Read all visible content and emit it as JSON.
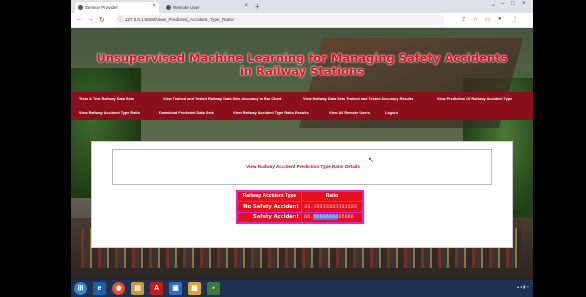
{
  "browser": {
    "tabs": [
      {
        "label": "Service Provider"
      },
      {
        "label": "Remote User"
      }
    ],
    "new_tab": "+",
    "url": "127.0.0.1:8000/View_Predicted_Accident_Type_Ratio/"
  },
  "site": {
    "title": "Unsupervised Machine Learning for Managing Safety Accidents in Railway Stations"
  },
  "menu": {
    "row1": [
      {
        "label": "Train & Test Railway Data Sets"
      },
      {
        "label": "View Trained and Tested Railway Data Sets Accuracy in Bar Chart"
      },
      {
        "label": "View Railway Data Sets Trained and Tested Accuracy Results"
      },
      {
        "label": "View Prediction Of Railway Accident Type"
      }
    ],
    "row2": [
      {
        "label": "View Railway Accident Type Ratio"
      },
      {
        "label": "Download Predicted Data Sets"
      },
      {
        "label": "View Railway Accident Type Ratio Results"
      },
      {
        "label": "View All Remote Users"
      },
      {
        "label": "Logout"
      }
    ]
  },
  "content": {
    "heading": "View Railway Accident Prediction Type Ratio Details",
    "table": {
      "headers": [
        "Railway Accident Type",
        "Ratio"
      ],
      "rows": [
        {
          "type": "No Safety Accident",
          "ratio": "33.33333333333333"
        },
        {
          "type": "Safety Accident",
          "ratio_prefix": "66.",
          "ratio_highlight": "66666666",
          "ratio_suffix": "66666"
        }
      ]
    }
  },
  "colors": {
    "title_red": "#e3102a",
    "menu_bg": "#8b0f1d",
    "table_border": "#d726d7",
    "table_cell": "#e5101c"
  },
  "icons": {
    "taskbar": [
      "windows-start-icon",
      "ie-icon",
      "chrome-icon",
      "folder-icon",
      "acrobat-icon",
      "app-icon",
      "explorer-icon",
      "terminal-icon"
    ]
  }
}
